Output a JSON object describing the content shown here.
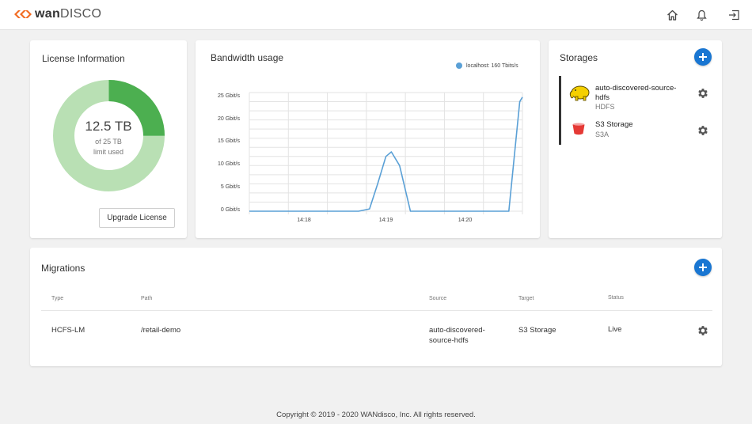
{
  "brand": {
    "name_bold": "wan",
    "name_rest": "DISCO"
  },
  "topbar": {
    "icons": [
      "home-icon",
      "bell-icon",
      "logout-icon"
    ]
  },
  "license": {
    "title": "License Information",
    "used_value": "12.5 TB",
    "total_text": "of 25 TB",
    "caption": "limit used",
    "used_fraction": 0.25,
    "button": "Upgrade License",
    "colors": {
      "used": "#4caf50",
      "remaining": "#b9e0b4"
    }
  },
  "bandwidth": {
    "title": "Bandwidth usage",
    "legend": "localhost: 160 Tbits/s"
  },
  "chart_data": {
    "type": "line",
    "title": "Bandwidth usage",
    "series": [
      {
        "name": "localhost: 160 Tbits/s",
        "color": "#5aa0d6",
        "x": [
          0,
          0.4,
          0.44,
          0.47,
          0.5,
          0.52,
          0.55,
          0.59,
          0.62,
          0.95,
          0.99,
          1.0
        ],
        "y": [
          0,
          0,
          0.5,
          6,
          12,
          13,
          10,
          0,
          0,
          0,
          24,
          25
        ]
      }
    ],
    "yticks": [
      "0 Gbit/s",
      "5 Gbit/s",
      "10 Gbit/s",
      "15 Gbit/s",
      "20 Gbit/s",
      "25 Gbit/s"
    ],
    "ytick_values": [
      0,
      5,
      10,
      15,
      20,
      25
    ],
    "xticks": [
      "14:18",
      "14:19",
      "14:20"
    ],
    "ylim": [
      0,
      26
    ],
    "grid": true,
    "legend_position": "top-right"
  },
  "storages": {
    "title": "Storages",
    "items": [
      {
        "name": "auto-discovered-source-hdfs",
        "type": "HDFS",
        "icon": "hadoop-elephant-icon"
      },
      {
        "name": "S3 Storage",
        "type": "S3A",
        "icon": "s3-bucket-icon"
      }
    ]
  },
  "migrations": {
    "title": "Migrations",
    "headers": [
      "Type",
      "Path",
      "Source",
      "Target",
      "Status"
    ],
    "rows": [
      {
        "type": "HCFS-LM",
        "path": "/retail-demo",
        "source": "auto-discovered-source-hdfs",
        "target": "S3 Storage",
        "status": "Live"
      }
    ]
  },
  "footer": "Copyright © 2019 - 2020 WANdisco, Inc. All rights reserved."
}
